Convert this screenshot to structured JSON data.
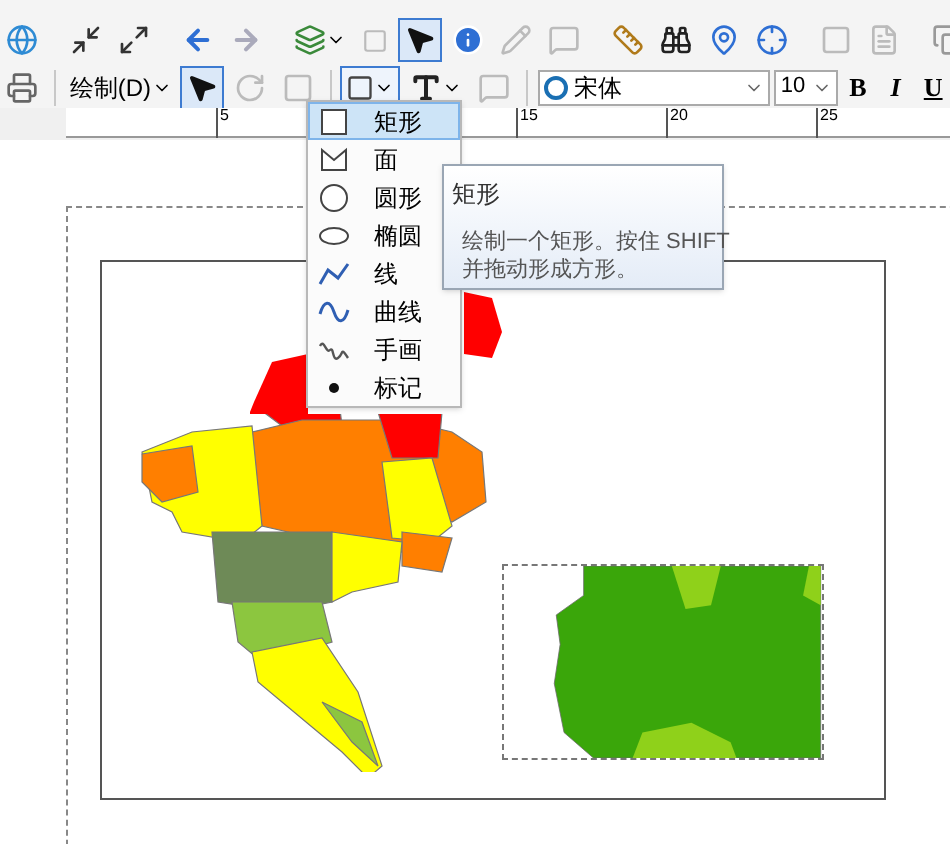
{
  "toolbar_1": {
    "select_elements_tool": {
      "selected": true
    }
  },
  "toolbar_2": {
    "draw_menu": "绘制(D)",
    "select_tool": {
      "selected": true
    },
    "shape_tool": {
      "open": true
    },
    "font_name": "宋体",
    "font_size": "10",
    "buttons": [
      "B",
      "I",
      "U"
    ]
  },
  "ruler": {
    "labels": [
      "5",
      "15",
      "20",
      "25"
    ]
  },
  "shape_menu": {
    "items": [
      {
        "kind": "rectangle",
        "label": "矩形",
        "selected": true
      },
      {
        "kind": "polygon",
        "label": "面",
        "selected": false
      },
      {
        "kind": "circle",
        "label": "圆形",
        "selected": false
      },
      {
        "kind": "ellipse",
        "label": "椭圆",
        "selected": false
      },
      {
        "kind": "line",
        "label": "线",
        "selected": false
      },
      {
        "kind": "curve",
        "label": "曲线",
        "selected": false
      },
      {
        "kind": "freehand",
        "label": "手画",
        "selected": false
      },
      {
        "kind": "marker",
        "label": "标记",
        "selected": false
      }
    ]
  },
  "tooltip": {
    "title": "矩形",
    "lines": [
      "绘制一个矩形。按住 SHIFT",
      "并拖动形成方形。"
    ]
  }
}
